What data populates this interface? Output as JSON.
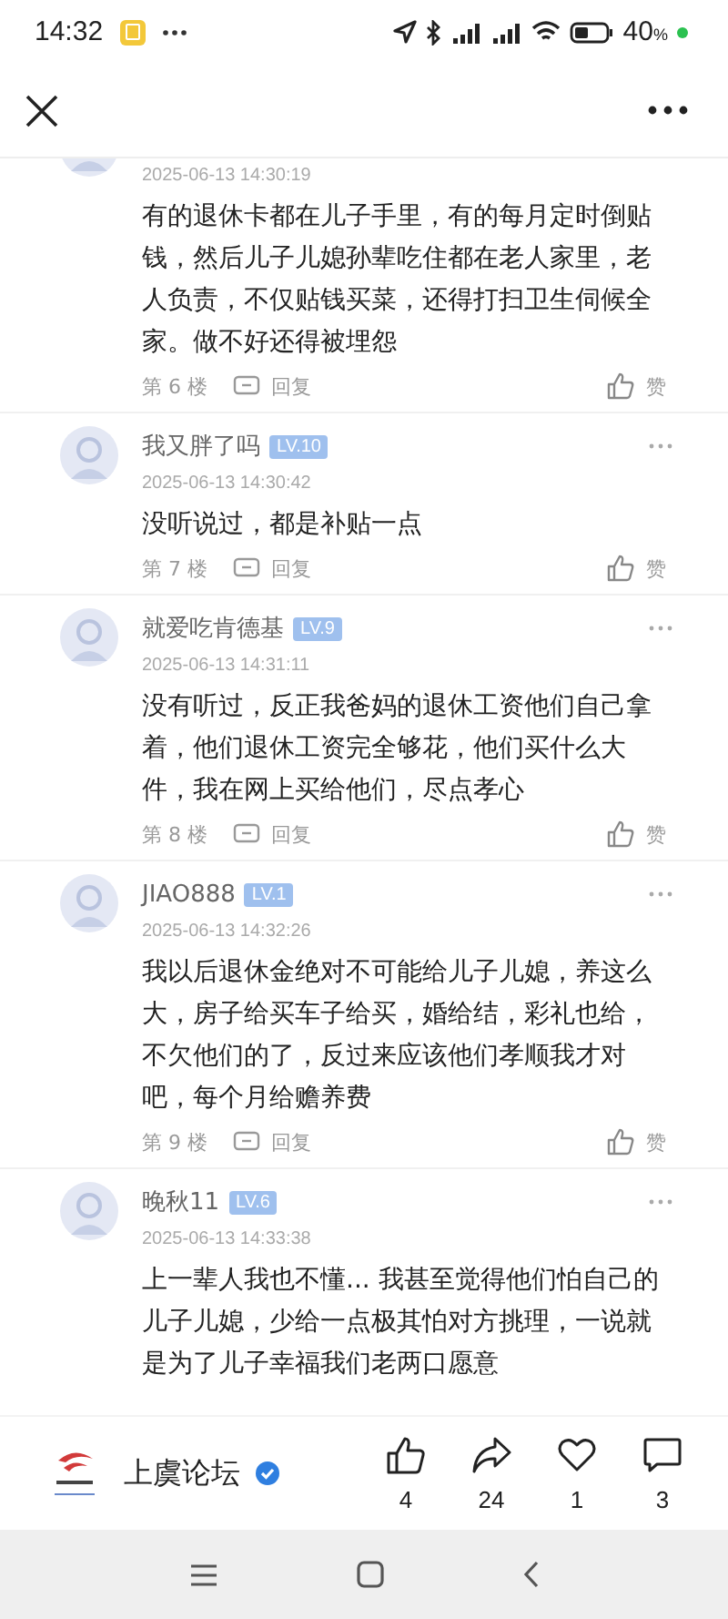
{
  "status_bar": {
    "time": "14:32",
    "battery": "40",
    "percent": "%"
  },
  "comments": [
    {
      "kind": "partial",
      "date": "2025-06-13 14:30:19",
      "text": "有的退休卡都在儿子手里，有的每月定时倒贴钱，然后儿子儿媳孙辈吃住都在老人家里，老人负责，不仅贴钱买菜，还得打扫卫生伺候全家。做不好还得被埋怨",
      "floor": "第 6 楼",
      "reply": "回复",
      "like": "赞"
    },
    {
      "kind": "full",
      "name": "我又胖了吗",
      "level": "LV.10",
      "date": "2025-06-13 14:30:42",
      "text": "没听说过，都是补贴一点",
      "floor": "第 7 楼",
      "reply": "回复",
      "like": "赞"
    },
    {
      "kind": "full",
      "name": "就爱吃肯德基",
      "level": "LV.9",
      "date": "2025-06-13 14:31:11",
      "text": "没有听过，反正我爸妈的退休工资他们自己拿着，他们退休工资完全够花，他们买什么大件，我在网上买给他们，尽点孝心",
      "floor": "第 8 楼",
      "reply": "回复",
      "like": "赞"
    },
    {
      "kind": "full",
      "name": "JIAO888",
      "level": "LV.1",
      "date": "2025-06-13 14:32:26",
      "text": "我以后退休金绝对不可能给儿子儿媳，养这么大，房子给买车子给买，婚给结，彩礼也给，不欠他们的了，反过来应该他们孝顺我才对吧，每个月给赡养费",
      "floor": "第 9 楼",
      "reply": "回复",
      "like": "赞"
    },
    {
      "kind": "full",
      "name": "晚秋11",
      "level": "LV.6",
      "date": "2025-06-13 14:33:38",
      "text": "上一辈人我也不懂... 我甚至觉得他们怕自己的儿子儿媳，少给一点极其怕对方挑理，一说就是为了儿子幸福我们老两口愿意"
    }
  ],
  "bottom_bar": {
    "account": "上虞论坛",
    "verified": true,
    "actions": [
      {
        "kind": "like",
        "count": "4"
      },
      {
        "kind": "share",
        "count": "24"
      },
      {
        "kind": "favorite",
        "count": "1"
      },
      {
        "kind": "comment",
        "count": "3"
      }
    ]
  }
}
